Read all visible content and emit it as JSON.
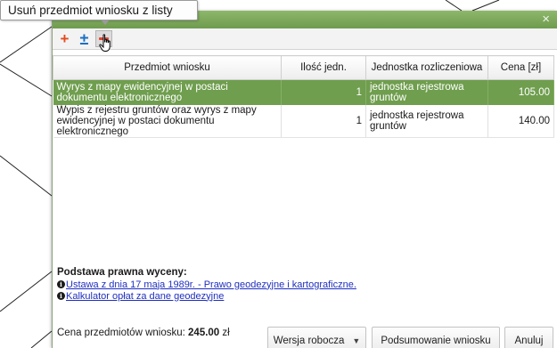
{
  "tooltip": {
    "text": "Usuń przedmiot wniosku z listy"
  },
  "dialog": {
    "close_glyph": "×"
  },
  "toolbar": {
    "add_glyph": "+",
    "edit_glyph": "±"
  },
  "table": {
    "headers": [
      "Przedmiot wniosku",
      "Ilość jedn.",
      "Jednostka rozliczeniowa",
      "Cena [zł]"
    ],
    "rows": [
      {
        "subject": "Wyrys z mapy ewidencyjnej w postaci dokumentu elektronicznego",
        "quantity": "1",
        "unit": "jednostka rejestrowa gruntów",
        "price": "105.00"
      },
      {
        "subject": "Wypis z rejestru gruntów oraz wyrys z mapy ewidencyjnej w postaci dokumentu elektronicznego",
        "quantity": "1",
        "unit": "jednostka rejestrowa gruntów",
        "price": "140.00"
      }
    ]
  },
  "legal_basis": {
    "heading": "Podstawa prawna wyceny:",
    "links": [
      "Ustawa z dnia 17 maja 1989r. - Prawo geodezyjne i kartograficzne.",
      "Kalkulator opłat za dane geodezyjne"
    ]
  },
  "summary": {
    "price_label": "Cena przedmiotów wniosku:",
    "price_value": "245.00",
    "currency": "zł"
  },
  "buttons": {
    "draft": "Wersja robocza",
    "summary": "Podsumowanie wniosku",
    "cancel": "Anuluj"
  },
  "colors": {
    "titlebar": "#7aa85a",
    "selected_row": "#6f9e4e",
    "link": "#1f2fbf",
    "add_icon": "#e24a1f",
    "edit_icon": "#1c6fc4",
    "remove_icon": "#e0452b"
  },
  "icons": [
    "add-icon",
    "edit-quantity-icon",
    "remove-icon",
    "info-icon",
    "close-icon",
    "dropdown-caret-icon",
    "hand-cursor-icon"
  ]
}
